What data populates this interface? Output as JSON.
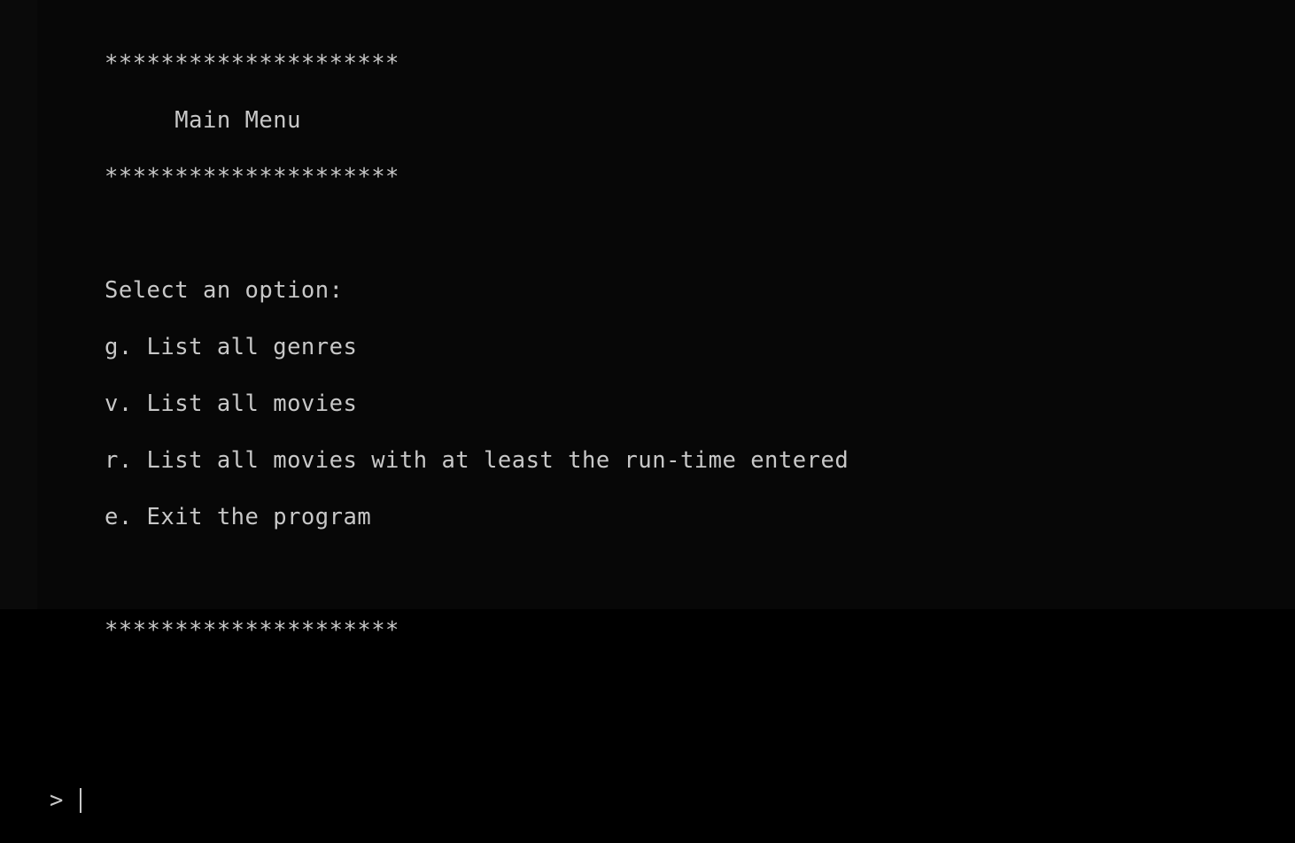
{
  "menu": {
    "divider": "*********************",
    "title": "     Main Menu",
    "select_prompt": "Select an option:",
    "options": [
      "g. List all genres",
      "v. List all movies",
      "r. List all movies with at least the run-time entered",
      "e. Exit the program"
    ]
  },
  "prompt": {
    "symbol": "> ",
    "value": ""
  }
}
